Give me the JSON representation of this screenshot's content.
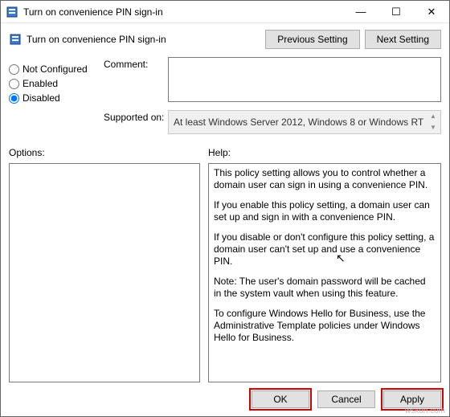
{
  "window": {
    "title": "Turn on convenience PIN sign-in",
    "minimize_glyph": "—",
    "maximize_glyph": "☐",
    "close_glyph": "✕"
  },
  "header": {
    "title": "Turn on convenience PIN sign-in",
    "prev_label": "Previous Setting",
    "next_label": "Next Setting"
  },
  "state": {
    "selected": "disabled",
    "not_configured_label": "Not Configured",
    "enabled_label": "Enabled",
    "disabled_label": "Disabled"
  },
  "fields": {
    "comment_label": "Comment:",
    "comment_value": "",
    "supported_label": "Supported on:",
    "supported_value": "At least Windows Server 2012, Windows 8 or Windows RT"
  },
  "panes": {
    "options_label": "Options:",
    "help_label": "Help:"
  },
  "help": {
    "p1": "This policy setting allows you to control whether a domain user can sign in using a convenience PIN.",
    "p2": "If you enable this policy setting, a domain user can set up and sign in with a convenience PIN.",
    "p3": "If you disable or don't configure this policy setting, a domain user can't set up and use a convenience PIN.",
    "p4": "Note: The user's domain password will be cached in the system vault when using this feature.",
    "p5": "To configure Windows Hello for Business, use the Administrative Template policies under Windows Hello for Business."
  },
  "footer": {
    "ok_label": "OK",
    "cancel_label": "Cancel",
    "apply_label": "Apply"
  },
  "watermark": "wsxdh.com"
}
